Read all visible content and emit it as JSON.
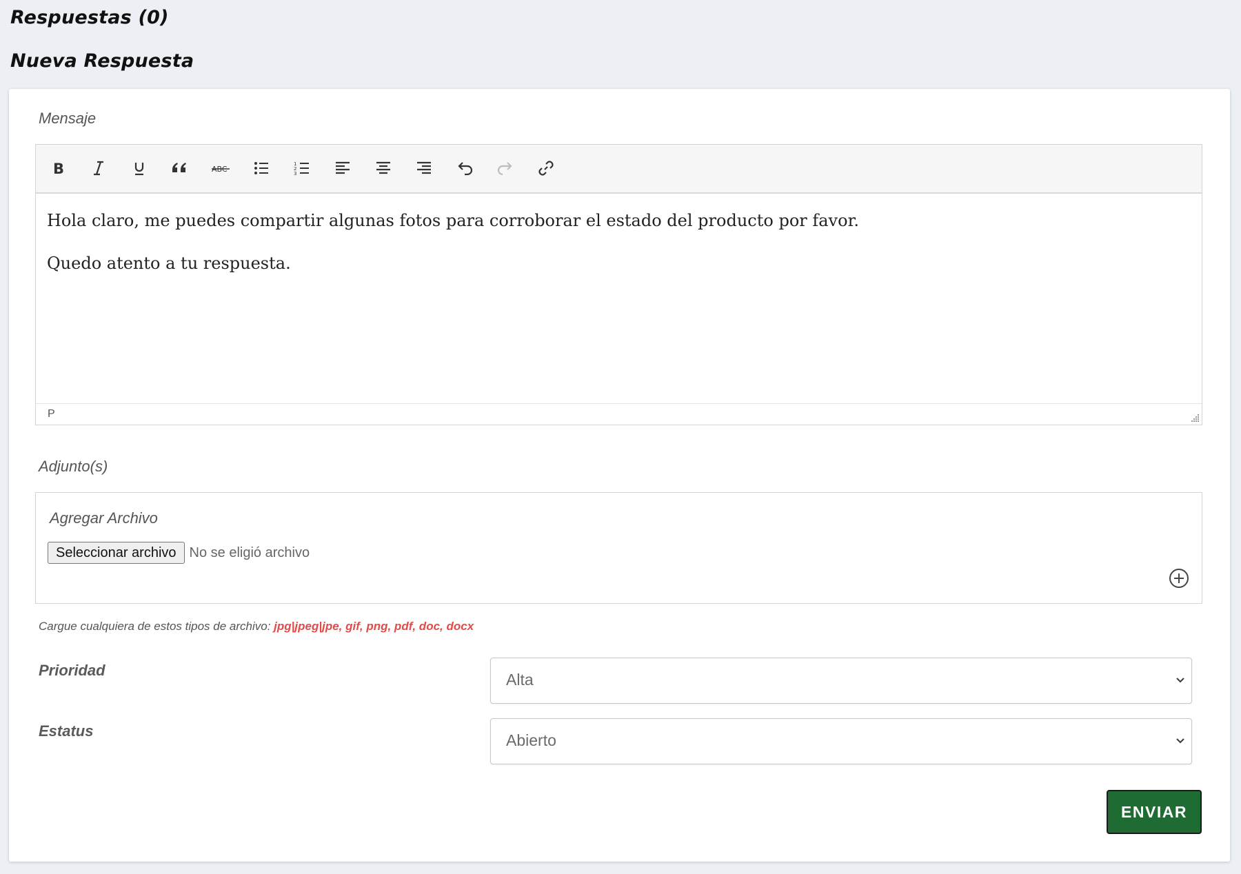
{
  "page": {
    "responses_title": "Respuestas (0)",
    "new_response_title": "Nueva Respuesta"
  },
  "editor": {
    "label": "Mensaje",
    "toolbar": [
      {
        "name": "bold-button",
        "icon": "bold-icon"
      },
      {
        "name": "italic-button",
        "icon": "italic-icon"
      },
      {
        "name": "underline-button",
        "icon": "underline-icon"
      },
      {
        "name": "blockquote-button",
        "icon": "quote-icon"
      },
      {
        "name": "strikethrough-button",
        "icon": "strikethrough-icon"
      },
      {
        "name": "bullet-list-button",
        "icon": "bullet-list-icon"
      },
      {
        "name": "numbered-list-button",
        "icon": "numbered-list-icon"
      },
      {
        "name": "align-left-button",
        "icon": "align-left-icon"
      },
      {
        "name": "align-center-button",
        "icon": "align-center-icon"
      },
      {
        "name": "align-right-button",
        "icon": "align-right-icon"
      },
      {
        "name": "undo-button",
        "icon": "undo-icon"
      },
      {
        "name": "redo-button",
        "icon": "redo-icon"
      },
      {
        "name": "link-button",
        "icon": "link-icon"
      }
    ],
    "content": [
      "Hola claro, me puedes compartir algunas fotos para corroborar el estado del producto por favor.",
      "Quedo atento a tu respuesta."
    ],
    "status_path": "P"
  },
  "attachments": {
    "label": "Adjunto(s)",
    "add_title": "Agregar Archivo",
    "choose_button": "Seleccionar archivo",
    "file_status": "No se eligió archivo",
    "help_prefix": "Cargue cualquiera de estos tipos de archivo: ",
    "help_types": "jpg|jpeg|jpe, gif, png, pdf, doc, docx"
  },
  "priority": {
    "label": "Prioridad",
    "selected": "Alta"
  },
  "status": {
    "label": "Estatus",
    "selected": "Abierto"
  },
  "actions": {
    "send_label": "ENVIAR"
  },
  "colors": {
    "page_background": "#eceff3",
    "send_button": "#1f6b34",
    "file_types": "#e34a4a",
    "toolbar_disabled": "#bdbdbd"
  }
}
